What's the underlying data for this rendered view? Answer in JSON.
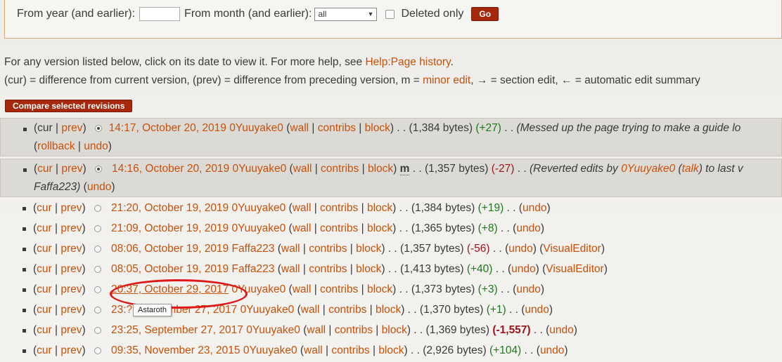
{
  "filter": {
    "from_year_label": "From year (and earlier):",
    "from_year_value": "",
    "from_month_label": "From month (and earlier):",
    "from_month_selected": "all",
    "deleted_only_label": "Deleted only",
    "go_label": "Go"
  },
  "info": {
    "line1_text": "For any version listed below, click on its date to view it. For more help, see ",
    "line1_link": "Help:Page history",
    "line1_end": ".",
    "line2_a": "(cur) = difference from current version, (prev) = difference from preceding version, m = ",
    "line2_link": "minor edit",
    "line2_b": ", → = section edit, ← = automatic edit summary"
  },
  "compare_label": "Compare selected revisions",
  "links": {
    "cur": "cur",
    "prev": "prev",
    "wall": "wall",
    "contribs": "contribs",
    "block": "block",
    "undo": "undo",
    "rollback": "rollback",
    "talk": "talk",
    "visual_editor": "VisualEditor",
    "minor": "m"
  },
  "revisions": [
    {
      "date": "14:17, October 20, 2019",
      "user": "0Yuuyake0",
      "bytes": "(1,384 bytes)",
      "diff": "(+27)",
      "comment": "(Messed up the page trying to make a guide lo"
    },
    {
      "date": "14:16, October 20, 2019",
      "user": "0Yuuyake0",
      "bytes": "(1,357 bytes)",
      "diff": "(-27)",
      "comment_a": "(Reverted edits by ",
      "comment_user": "0Yuuyake0",
      "comment_b": " to last v",
      "comment_c": "Faffa223)"
    },
    {
      "date": "21:20, October 19, 2019",
      "user": "0Yuuyake0",
      "bytes": "(1,384 bytes)",
      "diff": "(+19)"
    },
    {
      "date": "21:09, October 19, 2019",
      "user": "0Yuuyake0",
      "bytes": "(1,365 bytes)",
      "diff": "(+8)"
    },
    {
      "date": "08:06, October 19, 2019",
      "user": "Faffa223",
      "bytes": "(1,357 bytes)",
      "diff": "(-56)"
    },
    {
      "date": "08:05, October 19, 2019",
      "user": "Faffa223",
      "bytes": "(1,413 bytes)",
      "diff": "(+40)"
    },
    {
      "date": "20:37, October 29, 2017",
      "user": "0Yuuyake0",
      "bytes": "(1,373 bytes)",
      "diff": "(+3)"
    },
    {
      "date": "23:?, September 27, 2017",
      "user": "0Yuuyake0",
      "bytes": "(1,370 bytes)",
      "diff": "(+1)"
    },
    {
      "date": "23:25, September 27, 2017",
      "user": "0Yuuyake0",
      "bytes": "(1,369 bytes)",
      "diff": "(-1,557)"
    },
    {
      "date": "09:35, November 23, 2015",
      "user": "0Yuuyake0",
      "bytes": "(2,926 bytes)",
      "diff": "(+104)"
    }
  ],
  "tooltip": "Astaroth"
}
